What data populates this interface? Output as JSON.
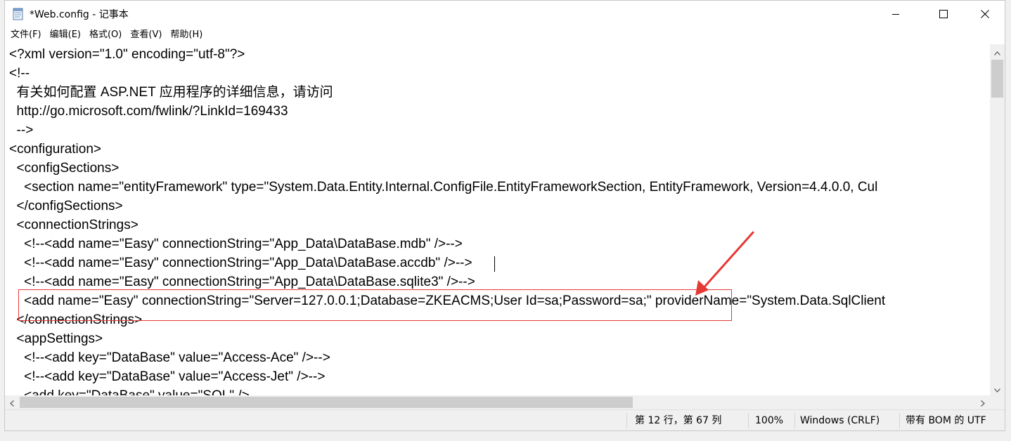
{
  "window": {
    "title": "*Web.config - 记事本"
  },
  "menu": [
    {
      "label": "文件(F)"
    },
    {
      "label": "编辑(E)"
    },
    {
      "label": "格式(O)"
    },
    {
      "label": "查看(V)"
    },
    {
      "label": "帮助(H)"
    }
  ],
  "editor": {
    "lines": [
      "<?xml version=\"1.0\" encoding=\"utf-8\"?>",
      "<!--",
      "  有关如何配置 ASP.NET 应用程序的详细信息，请访问",
      "  http://go.microsoft.com/fwlink/?LinkId=169433",
      "  -->",
      "<configuration>",
      "  <configSections>",
      "    <section name=\"entityFramework\" type=\"System.Data.Entity.Internal.ConfigFile.EntityFrameworkSection, EntityFramework, Version=4.4.0.0, Cul",
      "  </configSections>",
      "  <connectionStrings>",
      "    <!--<add name=\"Easy\" connectionString=\"App_Data\\DataBase.mdb\" />-->",
      "    <!--<add name=\"Easy\" connectionString=\"App_Data\\DataBase.accdb\" />-->",
      "    <!--<add name=\"Easy\" connectionString=\"App_Data\\DataBase.sqlite3\" />-->",
      "    <add name=\"Easy\" connectionString=\"Server=127.0.0.1;Database=ZKEACMS;User Id=sa;Password=sa;\" providerName=\"System.Data.SqlClient",
      "  </connectionStrings>",
      "  <appSettings>",
      "    <!--<add key=\"DataBase\" value=\"Access-Ace\" />-->",
      "    <!--<add key=\"DataBase\" value=\"Access-Jet\" />-->",
      "    <add key=\"DataBase\" value=\"SQL\" />"
    ]
  },
  "status": {
    "position": "第 12 行，第 67 列",
    "zoom": "100%",
    "line_ending": "Windows (CRLF)",
    "encoding": "带有 BOM 的 UTF"
  },
  "colors": {
    "annotation": "#e53935"
  },
  "icons": {
    "app": "notepad-icon",
    "minimize": "minimize-icon",
    "maximize": "maximize-icon",
    "close": "close-icon"
  }
}
